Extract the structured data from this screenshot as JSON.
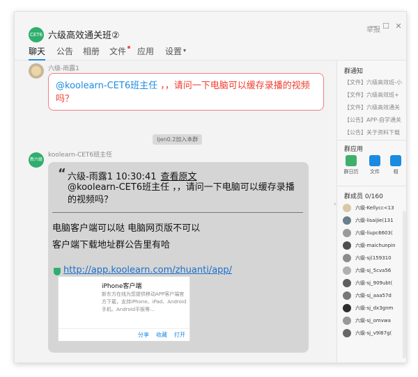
{
  "window": {
    "group_avatar_text": "CET6",
    "title": "六级高效通关班②",
    "report": "举报",
    "minimize_glyph": "—",
    "maximize_glyph": "☐",
    "close_glyph": "✕"
  },
  "tabs": [
    "聊天",
    "公告",
    "相册",
    "文件",
    "应用",
    "设置"
  ],
  "tab_dropdown_glyph": "▾",
  "messages": {
    "m1": {
      "sender": "六级-雨露1",
      "mention": "@koolearn-CET6班主任",
      "text": " ，，请问一下电脑可以缓存录播的视频吗？"
    },
    "system": "Ijen0.2加入本群",
    "m2": {
      "sender": "koolearn-CET6班主任",
      "avatar_text": "新六级",
      "quote_mark": "“",
      "quote_header": "六级-雨露1    10:30:41",
      "view_original": "查看原文",
      "quote_body": "@koolearn-CET6班主任 ，，请问一下电脑可以缓存录播的视频吗？",
      "reply_line1": "电脑客户端可以哒  电脑网页版不可以",
      "reply_line2": "客户端下载地址群公告里有哈",
      "url": "http://app.koolearn.com/zhuanti/app/",
      "card": {
        "title": "iPhone客户端",
        "desc": "新东方在线为您提供移动APP客户端官方下载，支持iPhone、iPad、Android手机、Android平板等...",
        "share": "分享",
        "save": "收藏",
        "open": "打开"
      }
    }
  },
  "sidebar": {
    "notice_title": "群通知",
    "notices": [
      "【文件】六级高效班-小",
      "【文件】六级高效班+",
      "【文件】六级高效通关",
      "【公告】APP-自学通关",
      "【公告】关于资料下载"
    ],
    "apps_title": "群应用",
    "apps": [
      {
        "label": "群日历",
        "color": "#3fb06a"
      },
      {
        "label": "文件",
        "color": "#1b8be0"
      },
      {
        "label": "相",
        "color": "#1b8be0"
      }
    ],
    "members_title": "群成员 0/160",
    "members": [
      "六级-Kellycc<13",
      "六级-lisaijie(131",
      "六级-liupc6603(",
      "六级-maichunpin",
      "六级-sj(159310",
      "六级-sj_5cva56",
      "六级-sj_909ubt(",
      "六级-sj_aaa57d",
      "六级-sj_dx3gnm",
      "六级-sj_omvwa",
      "六级-sj_v9l87g("
    ]
  }
}
